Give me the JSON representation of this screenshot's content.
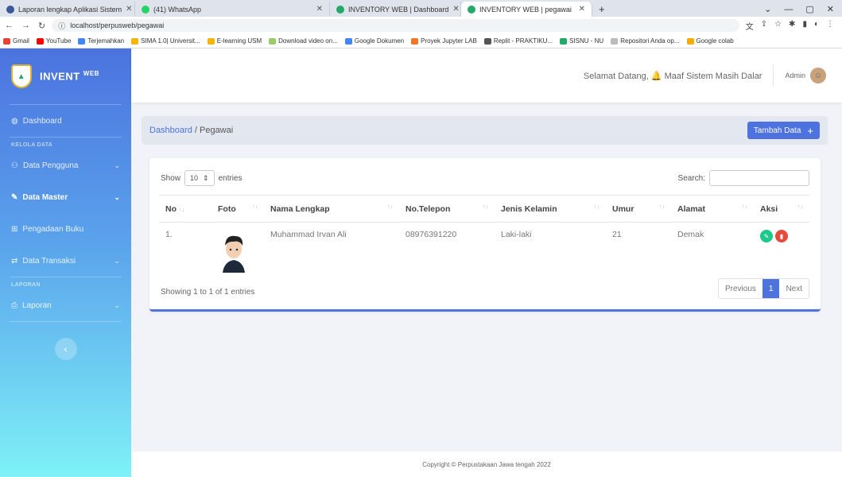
{
  "browser": {
    "tabs": [
      {
        "label": "Laporan lengkap Aplikasi Sistem",
        "color": "#3b5998"
      },
      {
        "label": "(41) WhatsApp",
        "color": "#25d366"
      },
      {
        "label": "INVENTORY WEB | Dashboard",
        "color": "#2a6"
      },
      {
        "label": "INVENTORY WEB | pegawai",
        "color": "#2a6"
      }
    ],
    "url": "localhost/perpusweb/pegawai",
    "bookmarks": [
      "Gmail",
      "YouTube",
      "Terjemahkan",
      "SIMA 1.0| Universit...",
      "E-learning USM",
      "Download video on...",
      "Google Dokumen",
      "Proyek Jupyter LAB",
      "Replit - PRAKTIKU...",
      "SISNU - NU",
      "Repositori Anda op...",
      "Google colab"
    ]
  },
  "sidebar": {
    "brand": "INVENT",
    "brand_sup": "WEB",
    "dashboard": "Dashboard",
    "section_kelola": "KELOLA DATA",
    "items": [
      "Data Pengguna",
      "Data Master",
      "Pengadaan Buku",
      "Data Transaksi"
    ],
    "section_laporan": "LAPORAN",
    "laporan": "Laporan"
  },
  "topbar": {
    "welcome": "Selamat Datang, 🔔 Maaf Sistem Masih Dalar",
    "user": "Admin"
  },
  "breadcrumb": {
    "home": "Dashboard",
    "current": " / Pegawai"
  },
  "add_button": "Tambah Data",
  "table": {
    "show": "Show",
    "entries_value": "10",
    "entries": "entries",
    "search": "Search:",
    "headers": [
      "No",
      "Foto",
      "Nama Lengkap",
      "No.Telepon",
      "Jenis Kelamin",
      "Umur",
      "Alamat",
      "Aksi"
    ],
    "rows": [
      {
        "no": "1.",
        "nama": "Muhammad Irvan Ali",
        "telp": "08976391220",
        "jk": "Laki-laki",
        "umur": "21",
        "alamat": "Demak"
      }
    ],
    "info": "Showing 1 to 1 of 1 entries",
    "prev": "Previous",
    "page": "1",
    "next": "Next"
  },
  "footer": "Copyright © Perpustakaan Jawa tengah 2022"
}
